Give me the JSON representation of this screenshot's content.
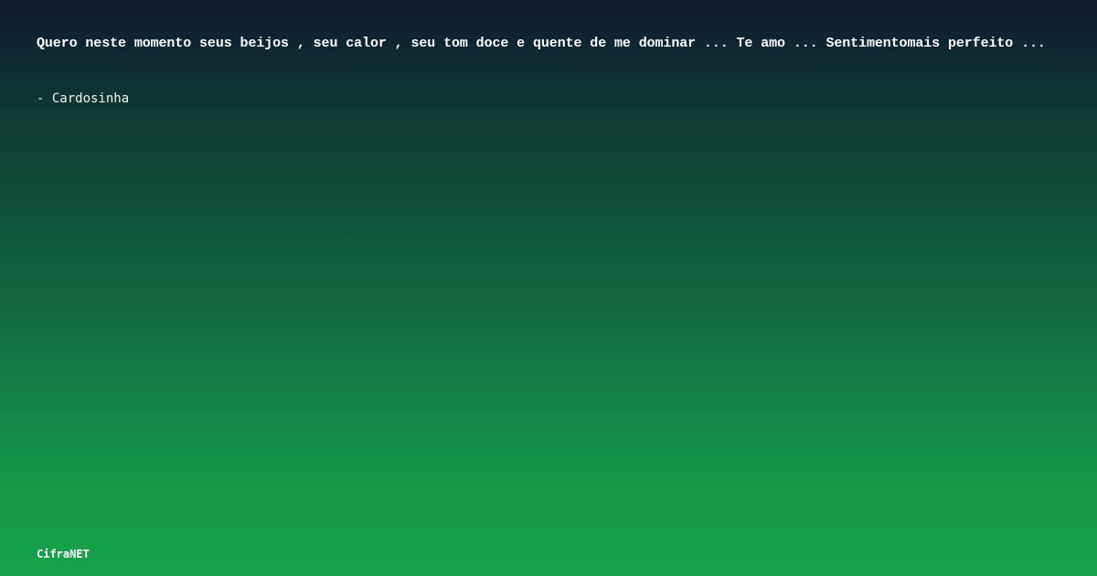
{
  "quote": {
    "text": "Quero neste momento seus beijos , seu calor , seu tom doce e quente de me dominar ... Te amo ... Sentimentomais perfeito ...",
    "author": "- Cardosinha"
  },
  "brand": {
    "name": "CifraNET"
  },
  "colors": {
    "gradient_top": "#0f1a2e",
    "gradient_bottom": "#17a049",
    "text": "#ffffff"
  }
}
